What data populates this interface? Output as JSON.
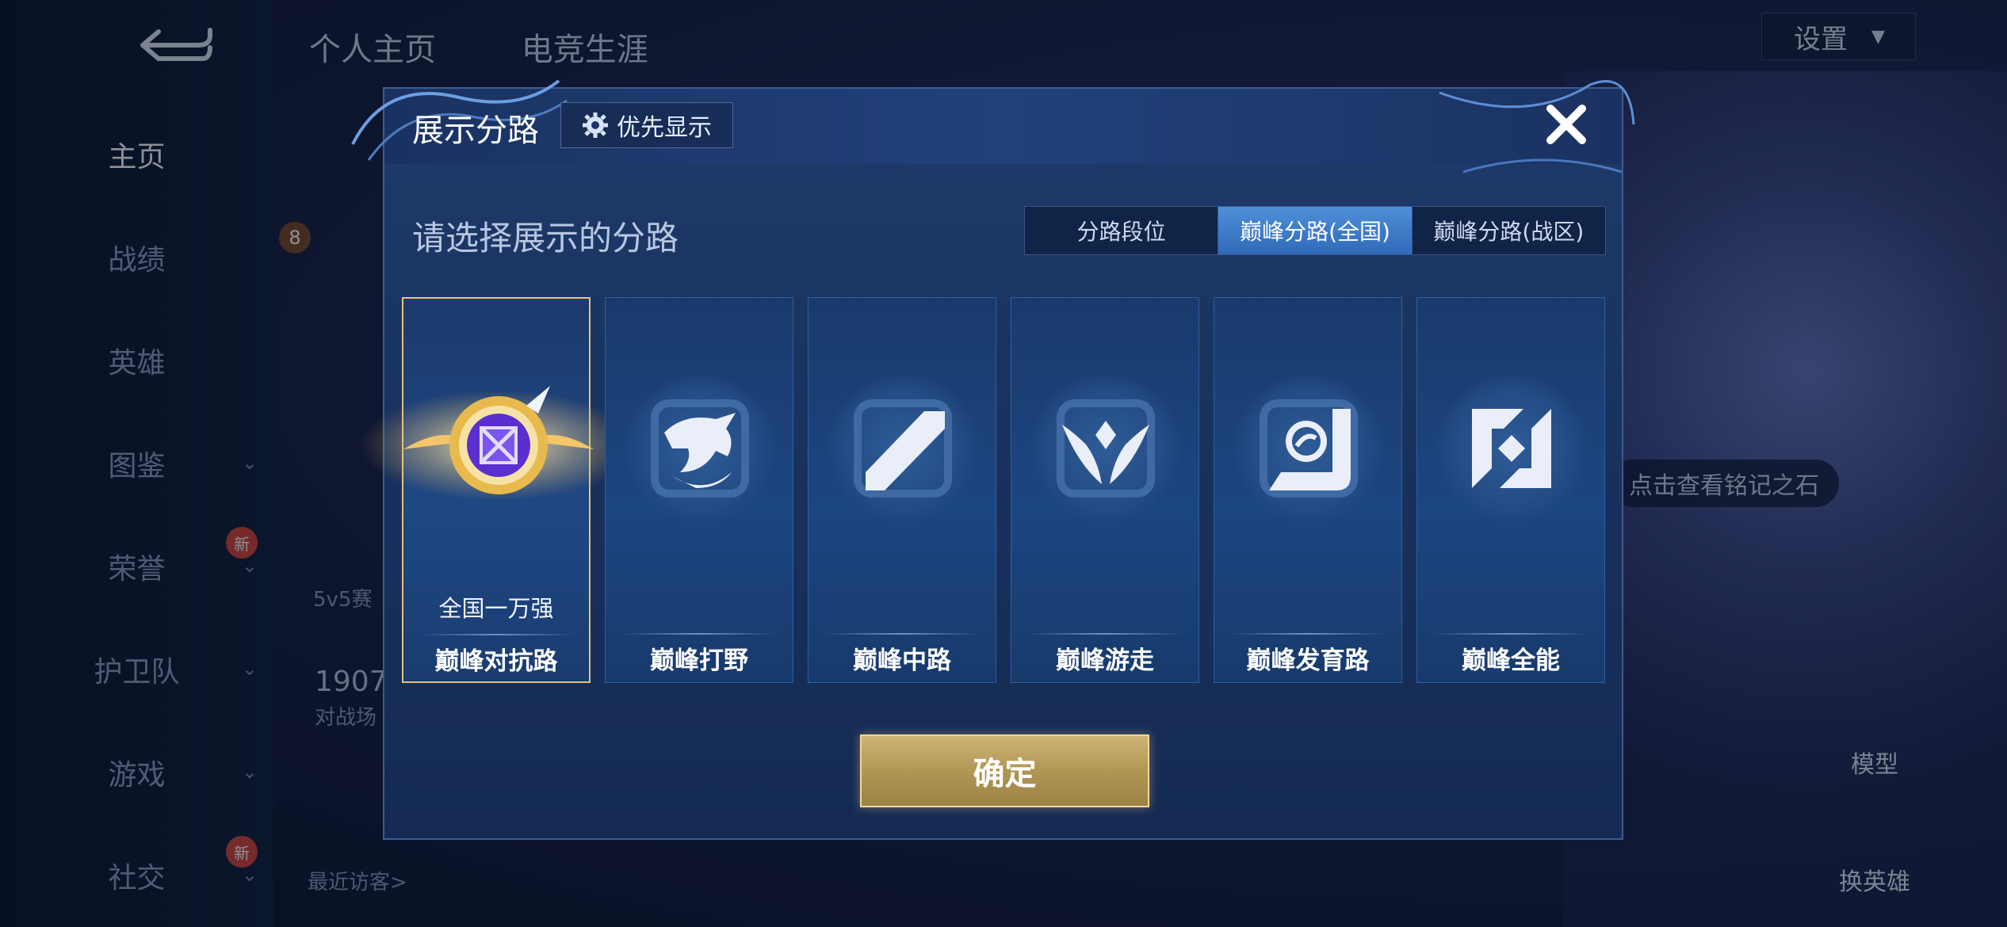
{
  "left_nav": {
    "items": [
      {
        "label": "主页",
        "active": true,
        "has_chevron": false,
        "badge": ""
      },
      {
        "label": "战绩",
        "active": false,
        "has_chevron": false,
        "badge": ""
      },
      {
        "label": "英雄",
        "active": false,
        "has_chevron": false,
        "badge": ""
      },
      {
        "label": "图鉴",
        "active": false,
        "has_chevron": true,
        "badge": ""
      },
      {
        "label": "荣誉",
        "active": false,
        "has_chevron": true,
        "badge": "新"
      },
      {
        "label": "护卫队",
        "active": false,
        "has_chevron": true,
        "badge": ""
      },
      {
        "label": "游戏",
        "active": false,
        "has_chevron": true,
        "badge": ""
      },
      {
        "label": "社交",
        "active": false,
        "has_chevron": true,
        "badge": "新"
      }
    ]
  },
  "top_tabs": [
    "个人主页",
    "电竞生涯"
  ],
  "settings_label": "设置",
  "background": {
    "level": "8",
    "match_label": "5v5赛",
    "count": "1907",
    "count_label": "对战场",
    "recent_visitors": "最近访客>",
    "inscription_hint": "点击查看铭记之石",
    "model_label": "模型",
    "switch_hero_label": "换英雄"
  },
  "modal": {
    "title": "展示分路",
    "priority_button": "优先显示",
    "prompt": "请选择展示的分路",
    "segments": [
      {
        "label": "分路段位",
        "active": false
      },
      {
        "label": "巅峰分路(全国)",
        "active": true
      },
      {
        "label": "巅峰分路(战区)",
        "active": false
      }
    ],
    "cards": [
      {
        "name": "巅峰对抗路",
        "rank": "全国一万强",
        "selected": true,
        "icon": "top-lane-badge-icon"
      },
      {
        "name": "巅峰打野",
        "rank": "",
        "selected": false,
        "icon": "jungle-dragon-icon"
      },
      {
        "name": "巅峰中路",
        "rank": "",
        "selected": false,
        "icon": "mid-lane-slash-icon"
      },
      {
        "name": "巅峰游走",
        "rank": "",
        "selected": false,
        "icon": "roam-wings-icon"
      },
      {
        "name": "巅峰发育路",
        "rank": "",
        "selected": false,
        "icon": "farm-lane-icon"
      },
      {
        "name": "巅峰全能",
        "rank": "",
        "selected": false,
        "icon": "all-round-icon"
      }
    ],
    "confirm_button": "确定"
  },
  "colors": {
    "accent_gold": "#e4c27a",
    "segment_active": "#3f7cc8",
    "modal_bg": "#1b355f"
  }
}
